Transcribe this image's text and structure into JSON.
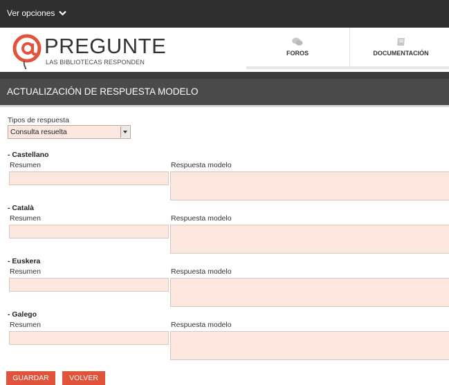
{
  "topbar": {
    "options_label": "Ver opciones"
  },
  "header": {
    "brand": "PREGUNTE",
    "tagline": "LAS BIBLIOTECAS RESPONDEN",
    "nav": [
      {
        "label": "FOROS",
        "icon": "speech-bubbles-icon"
      },
      {
        "label": "DOCUMENTACIÓN",
        "icon": "book-icon"
      }
    ]
  },
  "page": {
    "title": "ACTUALIZACIÓN DE RESPUESTA MODELO"
  },
  "form": {
    "type_label": "Tipos de respuesta",
    "type_value": "Consulta resuelta",
    "resumen_label": "Resumen",
    "modelo_label": "Respuesta modelo",
    "languages": [
      {
        "name": "- Castellano"
      },
      {
        "name": "- Català"
      },
      {
        "name": "- Euskera"
      },
      {
        "name": "- Galego"
      }
    ],
    "save_label": "GUARDAR",
    "back_label": "VOLVER"
  },
  "colors": {
    "accent": "#e2533c",
    "topbar": "#2f2f2f",
    "titlebar": "#4a4a4a",
    "input_bg": "#fbe7dd"
  }
}
